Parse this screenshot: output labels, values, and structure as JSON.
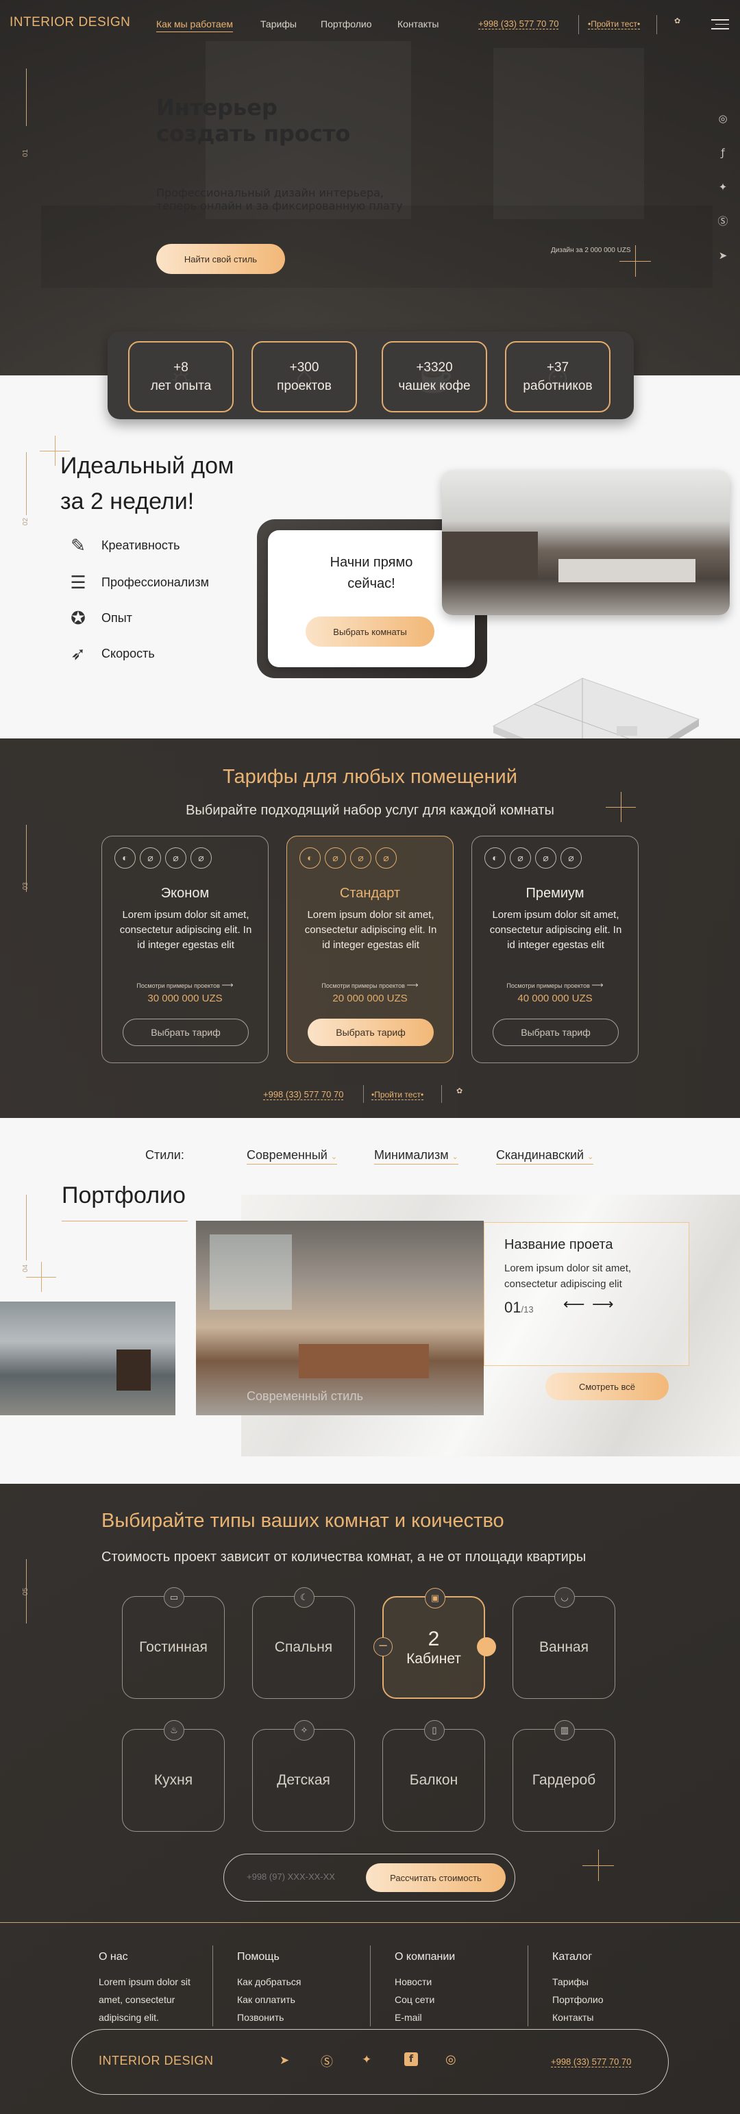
{
  "header": {
    "logo": "INTERIOR DESIGN",
    "nav": [
      "Как мы работаем",
      "Тарифы",
      "Портфолио",
      "Контакты"
    ],
    "phone": "+998 (33) 577 70 70",
    "test_button": "•Пройти тест•",
    "menu_icon": "hamburger-icon"
  },
  "hero": {
    "title_line1": "Интерьер",
    "title_line2": "создать просто",
    "subtitle_line1": "Профессиональный дизайн интерьера,",
    "subtitle_line2": "теперь онлайн и за фиксированную плату",
    "cta": "Найти свой стиль",
    "price_note": "Дизайн за 2 000 000 UZS",
    "section_number": "01",
    "social_icons": [
      "instagram-icon",
      "facebook-icon",
      "twitter-icon",
      "skype-icon",
      "telegram-icon"
    ]
  },
  "stats": [
    {
      "value": "+8",
      "label": "лет опыта"
    },
    {
      "value": "+300",
      "label": "проектов"
    },
    {
      "value": "+3320",
      "label": "чашек кофе"
    },
    {
      "value": "+37",
      "label": "работников"
    }
  ],
  "about": {
    "section_number": "02",
    "title_line1": "Идеальный дом",
    "title_line2": "за 2 недели!",
    "features": [
      "Креативность",
      "Профессионализм",
      "Опыт",
      "Скорость"
    ],
    "card_title_line1": "Начни прямо",
    "card_title_line2": "сейчас!",
    "card_button": "Выбрать комнаты"
  },
  "tariffs": {
    "section_number": "03",
    "title": "Тарифы для любых помещений",
    "subtitle": "Выбирайте подходящий набор услуг для каждой комнаты",
    "cards": [
      {
        "name": "Эконом",
        "desc": "Lorem ipsum dolor sit amet, consectetur adipiscing elit. In id integer egestas elit",
        "look": "Посмотри примеры проектов",
        "price": "30 000 000 UZS",
        "button": "Выбрать тариф"
      },
      {
        "name": "Стандарт",
        "desc": "Lorem ipsum dolor sit amet, consectetur adipiscing elit. In id integer egestas elit",
        "look": "Посмотри примеры проектов",
        "price": "20 000 000 UZS",
        "button": "Выбрать тариф"
      },
      {
        "name": "Премиум",
        "desc": "Lorem ipsum dolor sit amet, consectetur adipiscing elit. In id integer egestas elit",
        "look": "Посмотри примеры проектов",
        "price": "40 000 000 UZS",
        "button": "Выбрать тариф"
      }
    ],
    "phone": "+998 (33) 577 70 70",
    "test_button": "•Пройти тест•"
  },
  "portfolio": {
    "section_number": "04",
    "styles_label": "Стили:",
    "styles": [
      "Современный",
      "Минимализм",
      "Скандинавский"
    ],
    "title": "Портфолио",
    "image_caption": "Современный стиль",
    "project_title": "Название проета",
    "project_desc": "Lorem ipsum dolor sit amet, consectetur adipiscing elit",
    "counter_current": "01",
    "counter_total": "/13",
    "see_all": "Смотреть всё"
  },
  "rooms": {
    "section_number": "05",
    "title": "Выбирайте типы ваших комнат и коичество",
    "subtitle": "Стоимость проект зависит от количества комнат, а не от площади квартиры",
    "items": [
      "Гостинная",
      "Спальня",
      "Кабинет",
      "Ванная",
      "Кухня",
      "Детская",
      "Балкон",
      "Гардероб"
    ],
    "selected_count": "2",
    "minus": "−",
    "phone_placeholder": "+998 (97) XXX-XX-XX",
    "calc_button": "Рассчитать стоимость"
  },
  "footer": {
    "columns": [
      {
        "title": "О нас",
        "items": [
          "Lorem ipsum dolor sit",
          "amet, consectetur",
          "adipiscing elit."
        ]
      },
      {
        "title": "Помощь",
        "items": [
          "Как добраться",
          "Как оплатить",
          "Позвонить"
        ]
      },
      {
        "title": "О компании",
        "items": [
          "Новости",
          "Соц сети",
          "E-mail"
        ]
      },
      {
        "title": "Каталог",
        "items": [
          "Тарифы",
          "Портфолио",
          "Контакты"
        ]
      }
    ],
    "logo": "INTERIOR DESIGN",
    "phone": "+998 (33) 577 70 70"
  },
  "colors": {
    "accent": "#e8b373",
    "dark": "#3c3a38",
    "light": "#f7f7f7"
  }
}
